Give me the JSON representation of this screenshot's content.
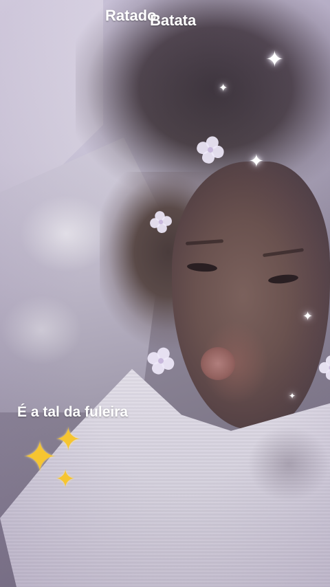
{
  "story": {
    "captions": {
      "top_word_1": "Ratado",
      "top_word_2": "Batata",
      "middle_caption": "É a tal da fuleira"
    },
    "stickers": {
      "sparkles_icon": "gold-sparkles-icon",
      "flower_icon": "flower-icon",
      "twinkle_icon": "star-twinkle-icon"
    },
    "colors": {
      "caption_text": "#ffffff",
      "sparkle_gold": "#f6c531",
      "filter_tint": "#b9b3c6"
    }
  }
}
